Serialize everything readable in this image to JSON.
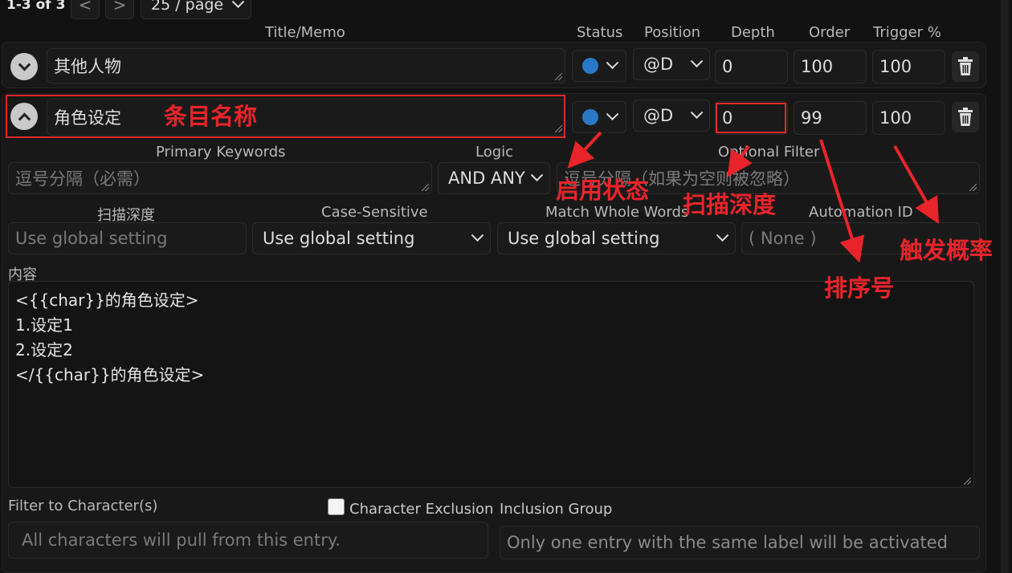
{
  "pagination": {
    "range": "1-3 of 3",
    "prev": "<",
    "next": ">",
    "per_page": "25 / page"
  },
  "headers": {
    "title": "Title/Memo",
    "status": "Status",
    "position": "Position",
    "depth": "Depth",
    "order": "Order",
    "trigger": "Trigger %"
  },
  "entry1": {
    "title": "其他人物",
    "status_icon": "blue-circle",
    "position": "@D",
    "depth": "0",
    "order": "100",
    "trigger": "100"
  },
  "entry2": {
    "title": "角色设定",
    "status_icon": "blue-circle",
    "position": "@D",
    "depth": "0",
    "order": "99",
    "trigger": "100",
    "primary_keywords_label": "Primary Keywords",
    "primary_keywords_placeholder": "逗号分隔（必需）",
    "logic_label": "Logic",
    "logic_value": "AND ANY",
    "optional_filter_label": "Optional Filter",
    "optional_filter_placeholder": "逗号分隔（如果为空则被忽略）",
    "scan_depth_label": "扫描深度",
    "scan_depth_placeholder": "Use global setting",
    "case_sensitive_label": "Case-Sensitive",
    "case_sensitive_value": "Use global setting",
    "match_whole_words_label": "Match Whole Words",
    "match_whole_words_value": "Use global setting",
    "automation_id_label": "Automation ID",
    "automation_id_placeholder": "( None )",
    "content_label": "内容",
    "content_lines": [
      "<{{char}}的角色设定>",
      "1.设定1",
      "2.设定2",
      "</{{char}}的角色设定>"
    ],
    "filter_label": "Filter to Character(s)",
    "character_exclusion_label": "Character Exclusion",
    "inclusion_group_label": "Inclusion Group",
    "filter_placeholder": "All characters will pull from this entry.",
    "inclusion_group_placeholder": "Only one entry with the same label will be activated"
  },
  "annotations": {
    "entry_name": "条目名称",
    "enable_status": "启用状态",
    "scan_depth": "扫描深度",
    "order_number": "排序号",
    "trigger_probability": "触发概率",
    "color": "#e8242a"
  },
  "colors": {
    "background": "#121212",
    "status_dot": "#2a78c8",
    "annotation_red": "#e8242a"
  }
}
